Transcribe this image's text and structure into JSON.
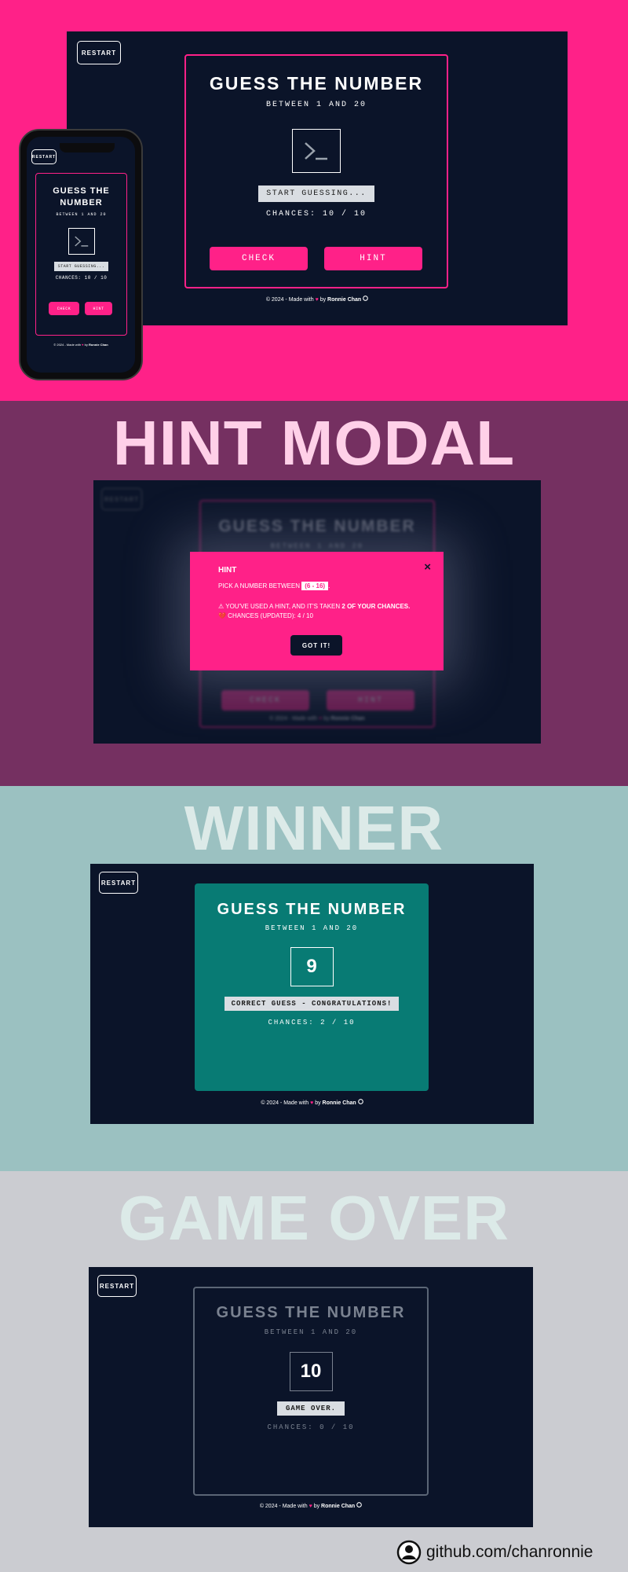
{
  "app": {
    "restart_label": "RESTART",
    "title": "GUESS THE NUMBER",
    "subtitle": "BETWEEN 1 AND 20",
    "footer_prefix": "© 2024 - Made with",
    "footer_by": "by",
    "footer_author": "Ronnie Chan",
    "heart_glyph": "♥",
    "github_icon": "github-icon"
  },
  "initial": {
    "number_display": "",
    "status": "START GUESSING...",
    "chances": "CHANCES: 10 / 10",
    "check_label": "CHECK",
    "hint_label": "HINT"
  },
  "sections": {
    "hint_modal": "HINT MODAL",
    "winner": "WINNER",
    "game_over": "GAME OVER"
  },
  "hint_modal": {
    "heading": "HINT",
    "text_prefix": "PICK A NUMBER BETWEEN",
    "range": "(6 - 16)",
    "text_suffix": ".",
    "warning_prefix": "⚠ YOU'VE USED A HINT, AND IT'S TAKEN",
    "warning_bold": "2 OF YOUR CHANCES.",
    "updated": "💔 CHANCES (UPDATED): 4 / 10",
    "button": "GOT IT!",
    "close": "×",
    "bg_title": "GUESS THE NUMBER",
    "bg_subtitle": "BETWEEN 1 AND 20",
    "bg_check": "CHECK",
    "bg_hint": "HINT"
  },
  "winner": {
    "number": "9",
    "status": "CORRECT GUESS - CONGRATULATIONS!",
    "chances": "CHANCES: 2 / 10"
  },
  "game_over": {
    "number": "10",
    "status": "GAME OVER.",
    "chances": "CHANCES: 0 / 10"
  },
  "credit": {
    "text": "github.com/chanronnie",
    "icon": "user-avatar-icon"
  },
  "colors": {
    "pink": "#ff2188",
    "navy": "#0b1429",
    "plum": "#753061",
    "teal_bg": "#9bc1c1",
    "teal_card": "#087b74",
    "grey_bg": "#cbccd1"
  }
}
